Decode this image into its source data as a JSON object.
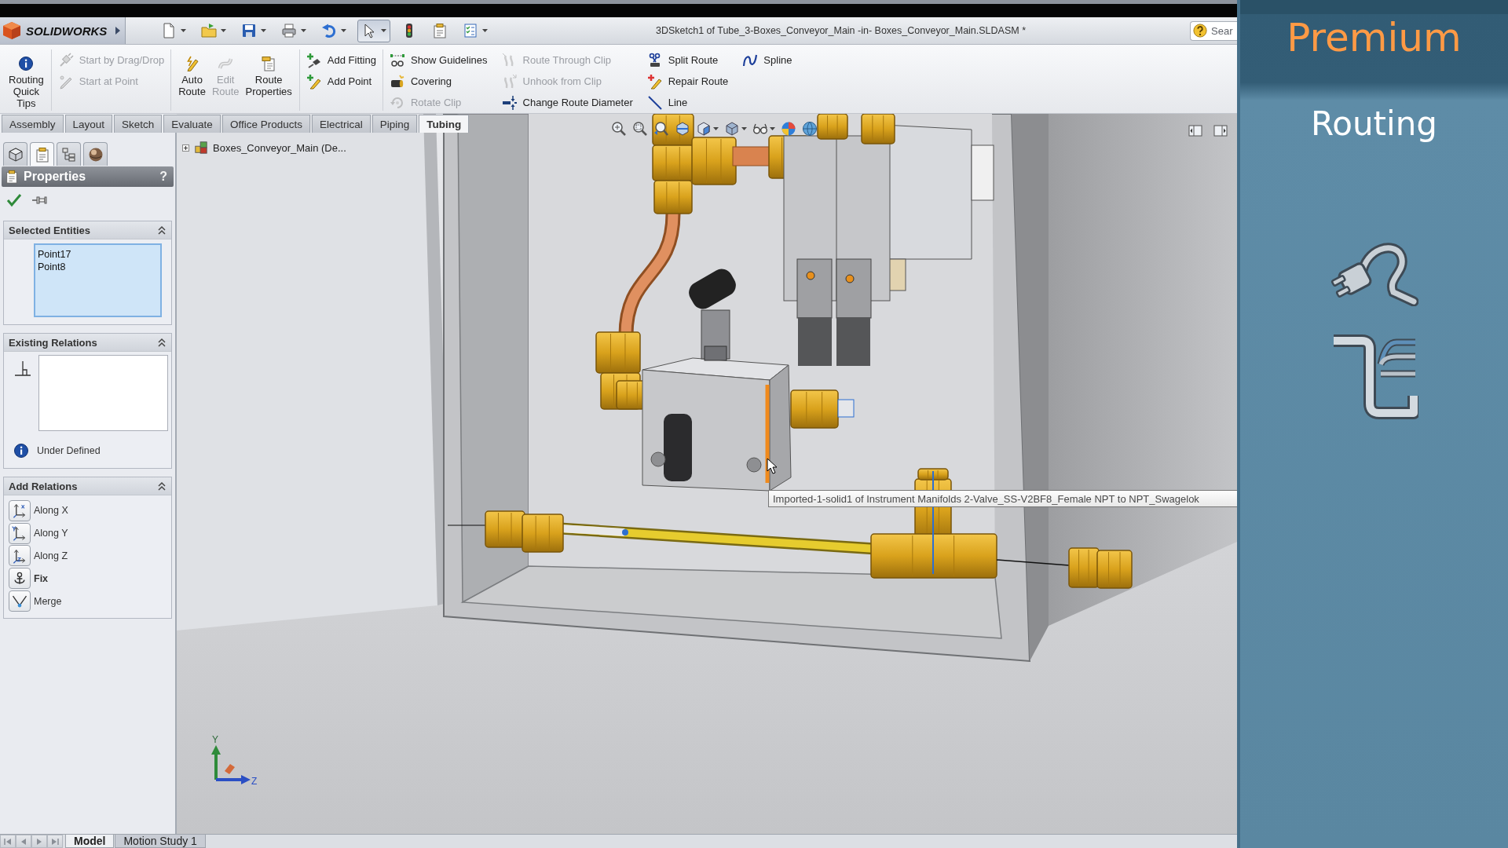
{
  "window": {
    "logo": "SOLIDWORKS",
    "title": "3DSketch1 of Tube_3-Boxes_Conveyor_Main -in- Boxes_Conveyor_Main.SLDASM *",
    "search": {
      "placeholder": "Sear"
    }
  },
  "quick_access": [
    {
      "kind": "new",
      "dropdown": true,
      "pressed": false
    },
    {
      "kind": "open",
      "dropdown": true,
      "pressed": false
    },
    {
      "kind": "save",
      "dropdown": true,
      "pressed": false
    },
    {
      "kind": "print",
      "dropdown": true,
      "pressed": false
    },
    {
      "kind": "undo",
      "dropdown": true,
      "pressed": false
    },
    {
      "kind": "select",
      "dropdown": true,
      "pressed": true
    },
    {
      "kind": "rebuild",
      "dropdown": false,
      "pressed": false
    },
    {
      "kind": "properties",
      "dropdown": false,
      "pressed": false
    },
    {
      "kind": "options",
      "dropdown": true,
      "pressed": false
    }
  ],
  "command_manager": {
    "groups": [
      {
        "kind": "large",
        "buttons": [
          {
            "label": "Routing Quick Tips",
            "disabled": false
          }
        ]
      },
      {
        "kind": "stack",
        "buttons": [
          {
            "label": "Start by Drag/Drop",
            "disabled": true
          },
          {
            "label": "Start at Point",
            "disabled": true
          }
        ]
      },
      {
        "kind": "large",
        "buttons": [
          {
            "label": "Auto Route",
            "disabled": false
          },
          {
            "label": "Edit Route",
            "disabled": true
          },
          {
            "label": "Route Properties",
            "disabled": false
          }
        ]
      },
      {
        "kind": "stack",
        "buttons": [
          {
            "label": "Add Fitting",
            "disabled": false
          },
          {
            "label": "Add Point",
            "disabled": false
          }
        ]
      },
      {
        "kind": "stack",
        "buttons": [
          {
            "label": "Show Guidelines",
            "disabled": false
          },
          {
            "label": "Covering",
            "disabled": false
          },
          {
            "label": "Rotate Clip",
            "disabled": true
          },
          {
            "label": "Route Through Clip",
            "disabled": true
          },
          {
            "label": "Unhook from Clip",
            "disabled": true
          },
          {
            "label": "Change Route Diameter",
            "disabled": false
          },
          {
            "label": "Split Route",
            "disabled": false
          },
          {
            "label": "Repair Route",
            "disabled": false
          },
          {
            "label": "Line",
            "disabled": false
          },
          {
            "label": "Spline",
            "disabled": false
          }
        ]
      }
    ]
  },
  "tabs": [
    {
      "label": "Assembly",
      "selected": false
    },
    {
      "label": "Layout",
      "selected": false
    },
    {
      "label": "Sketch",
      "selected": false
    },
    {
      "label": "Evaluate",
      "selected": false
    },
    {
      "label": "Office Products",
      "selected": false
    },
    {
      "label": "Electrical",
      "selected": false
    },
    {
      "label": "Piping",
      "selected": false
    },
    {
      "label": "Tubing",
      "selected": true
    }
  ],
  "property_manager": {
    "tabs": [
      {
        "kind": "tree",
        "selected": false
      },
      {
        "kind": "property",
        "selected": true
      },
      {
        "kind": "configuration",
        "selected": false
      },
      {
        "kind": "display",
        "selected": false
      }
    ],
    "title": "Properties",
    "help": "?",
    "selected_entities": {
      "title": "Selected Entities",
      "expanded": true,
      "items": [
        "Point17",
        "Point8"
      ]
    },
    "existing_relations": {
      "title": "Existing Relations",
      "expanded": true,
      "status": "Under Defined"
    },
    "add_relations": {
      "title": "Add Relations",
      "expanded": true,
      "items": [
        {
          "label": "Along X",
          "emphasized": false
        },
        {
          "label": "Along Y",
          "emphasized": false
        },
        {
          "label": "Along Z",
          "emphasized": false
        },
        {
          "label": "Fix",
          "emphasized": true
        },
        {
          "label": "Merge",
          "emphasized": false
        }
      ]
    }
  },
  "viewport": {
    "tree_item": {
      "label": "Boxes_Conveyor_Main (De...",
      "expanded": false
    },
    "view_toolbar": [
      {
        "kind": "fit",
        "dropdown": false
      },
      {
        "kind": "area",
        "dropdown": false
      },
      {
        "kind": "previous",
        "dropdown": false
      },
      {
        "kind": "section",
        "dropdown": false
      },
      {
        "kind": "orientation",
        "dropdown": true
      },
      {
        "kind": "display",
        "dropdown": true
      },
      {
        "kind": "visibility",
        "dropdown": true
      },
      {
        "kind": "appearance",
        "dropdown": false
      },
      {
        "kind": "scene",
        "dropdown": false
      }
    ],
    "tooltip": "Imported-1-solid1 of Instrument Manifolds 2-Valve_SS-V2BF8_Female NPT to NPT_Swagelok",
    "triad": {
      "y_label": "Y",
      "z_label": "Z"
    }
  },
  "bottom_tabs": [
    {
      "label": "Model",
      "selected": true
    },
    {
      "label": "Motion Study 1",
      "selected": false
    }
  ],
  "promo": {
    "title": "Premium",
    "subtitle": "Routing"
  }
}
